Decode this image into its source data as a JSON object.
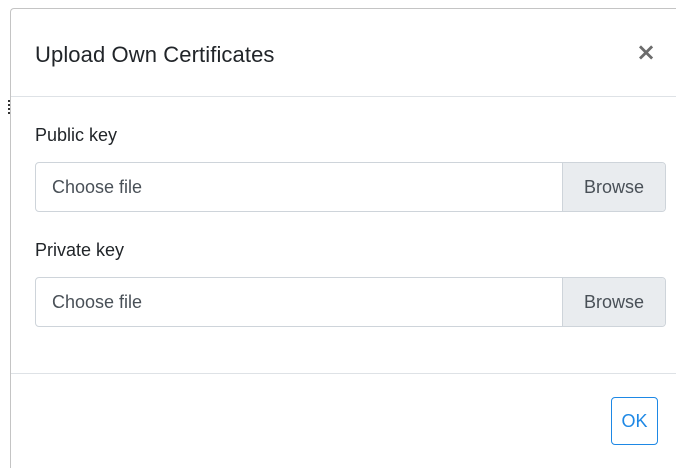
{
  "dialog": {
    "title": "Upload Own Certificates",
    "close_symbol": "×"
  },
  "fields": {
    "public_key": {
      "label": "Public key",
      "placeholder": "Choose file",
      "browse_label": "Browse"
    },
    "private_key": {
      "label": "Private key",
      "placeholder": "Choose file",
      "browse_label": "Browse"
    }
  },
  "footer": {
    "ok_label": "OK"
  },
  "icons": {
    "close": "close-icon"
  },
  "colors": {
    "accent": "#1e88e5",
    "browse_bg": "#e9ecef",
    "border": "#ced4da"
  }
}
